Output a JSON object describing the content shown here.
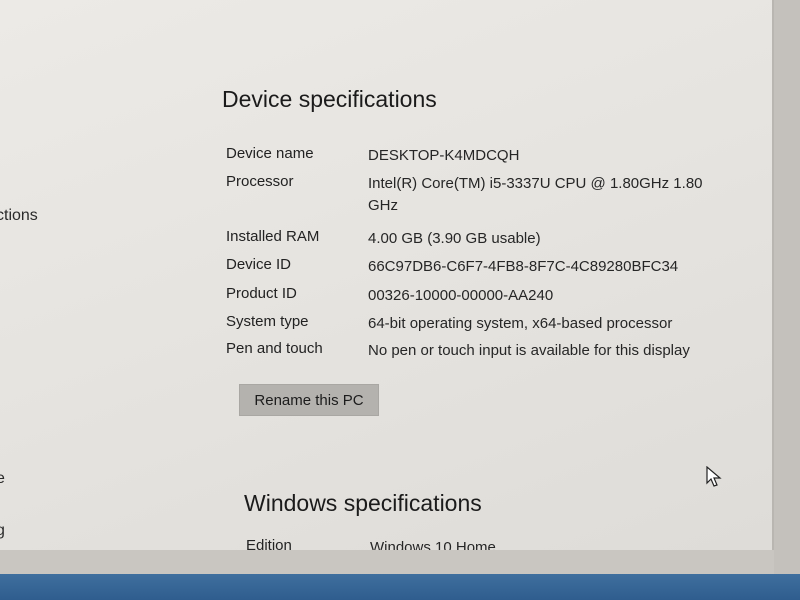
{
  "sidebar": {
    "items": [
      {
        "label": "ctions"
      },
      {
        "label": "e"
      },
      {
        "label": "g"
      }
    ]
  },
  "device_specs": {
    "heading": "Device specifications",
    "rows": [
      {
        "label": "Device name",
        "value": "DESKTOP-K4MDCQH"
      },
      {
        "label": "Processor",
        "value": "Intel(R) Core(TM) i5-3337U CPU @ 1.80GHz   1.80 GHz"
      },
      {
        "label": "Installed RAM",
        "value": "4.00 GB (3.90 GB usable)"
      },
      {
        "label": "Device ID",
        "value": "66C97DB6-C6F7-4FB8-8F7C-4C89280BFC34"
      },
      {
        "label": "Product ID",
        "value": "00326-10000-00000-AA240"
      },
      {
        "label": "System type",
        "value": "64-bit operating system, x64-based processor"
      },
      {
        "label": "Pen and touch",
        "value": "No pen or touch input is available for this display"
      }
    ],
    "rename_button": "Rename this PC"
  },
  "windows_specs": {
    "heading": "Windows specifications",
    "rows": [
      {
        "label": "Edition",
        "value": "Windows 10 Home"
      }
    ]
  },
  "icons": {
    "cursor": "mouse-pointer-icon"
  },
  "colors": {
    "background": "#e9e7e3",
    "button": "#b4b2ae",
    "taskbar": "#2f5d8e"
  }
}
